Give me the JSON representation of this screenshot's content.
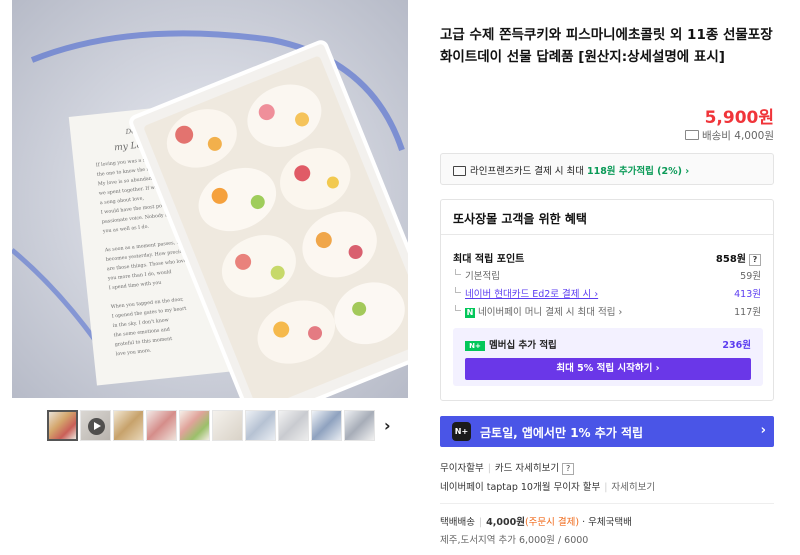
{
  "product": {
    "title": "고급 수제 쫀득쿠키와 피스마니에초콜릿 외 11종 선물포장 화이트데이 선물 답례품 [원산지:상세설명에 표시]",
    "price": "5,900원",
    "shipping_fee": "배송비 4,000원",
    "main_image_card": {
      "line1": "Dear,",
      "line2": "my Lover",
      "body": [
        "If loving you was a skill, it would be",
        "the one to know the most about.",
        "My love is so abundant to the days",
        "we spent together. If we were to sing",
        "a song about love,",
        "I would have the most powerful and",
        "passionate voice. Nobody knows",
        "you as well as I do.",
        "",
        "As soon as a moment passes, it",
        "becomes yesterday. How precious",
        "are those things. Those who love",
        "you more than I do, would",
        "I spend time with you",
        "",
        "When you tapped on the door,",
        "I opened the gates to my heart",
        "in the sky. I don't know",
        "the some emotions and",
        "grateful to this moment",
        "love you more."
      ]
    },
    "thumbnails_count": 10
  },
  "card_promo": {
    "text_prefix": "라인프렌즈카드 결제 시 최대 ",
    "text_highlight": "118원 추가적립 (2%) ›"
  },
  "benefits": {
    "title": "또사장몰 고객을 위한 혜택",
    "max_points_label": "최대 적립 포인트",
    "max_points_value": "858원",
    "help": "?",
    "rows": [
      {
        "label": "기본적립",
        "value": "59원"
      },
      {
        "label": "네이버 현대카드 Ed2로 결제 시 ›",
        "value": "413원"
      },
      {
        "label": "네이버페이 머니 결제 시 최대 적립 ›",
        "value": "117원",
        "badge": "N"
      }
    ],
    "membership": {
      "badge": "N+",
      "label": "멤버십 추가 적립",
      "value": "236원",
      "button": "최대 5% 적립 시작하기 ›"
    }
  },
  "banner": {
    "icon": "N+",
    "text": "금토일, 앱에서만 1% 추가 적립",
    "arrow": "›"
  },
  "installment": {
    "label1": "무이자할부",
    "link1": "카드 자세히보기",
    "help": "?",
    "label2": "네이버페이 taptap 10개월 무이자 할부",
    "link2": "자세히보기"
  },
  "delivery": {
    "type": "택배배송",
    "fee": "4,000원",
    "fee_note": "(주문시 결제)",
    "carrier": "· 우체국택배",
    "extra": "제주,도서지역 추가 6,000원 / 6000"
  },
  "colors": {
    "price": "#f0353a",
    "accent_green": "#03c75a",
    "banner_blue": "#4a55e7",
    "button_purple": "#6a37e8"
  }
}
